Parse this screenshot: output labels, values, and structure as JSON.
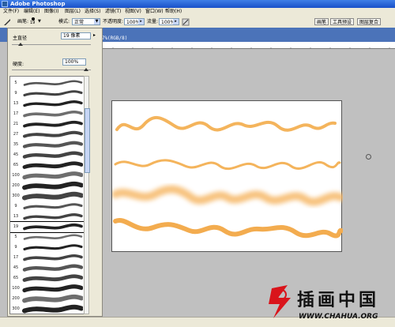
{
  "app": {
    "title": "Adobe Photoshop"
  },
  "menu": [
    "文件(F)",
    "编辑(E)",
    "图像(I)",
    "图层(L)",
    "选择(S)",
    "滤镜(T)",
    "视图(V)",
    "窗口(W)",
    "帮助(H)"
  ],
  "options": {
    "brush_label": "画笔:",
    "brush_size": "19",
    "mode_label": "模式:",
    "mode_value": "正常",
    "opacity_label": "不透明度:",
    "opacity_value": "100%",
    "flow_label": "流量:",
    "flow_value": "100%",
    "ws_buttons": [
      "画笔",
      "工具预设",
      "图层复合"
    ]
  },
  "document": {
    "title": "56.7%(RGB/8)"
  },
  "brush_panel": {
    "diameter_label": "主直径",
    "diameter_value": "19 像素",
    "hardness_label": "硬度:",
    "hardness_value": "100%",
    "brush_sizes": [
      "5",
      "9",
      "13",
      "17",
      "21",
      "27",
      "35",
      "45",
      "65",
      "100",
      "200",
      "300",
      "9",
      "13",
      "19",
      "5",
      "9",
      "17",
      "45",
      "65",
      "100",
      "200",
      "300"
    ]
  },
  "watermark": {
    "text": "插画中国",
    "url": "WWW.CHAHUA.ORG"
  },
  "colors": {
    "stroke": "#f4b45c",
    "title": "#1950c8"
  }
}
